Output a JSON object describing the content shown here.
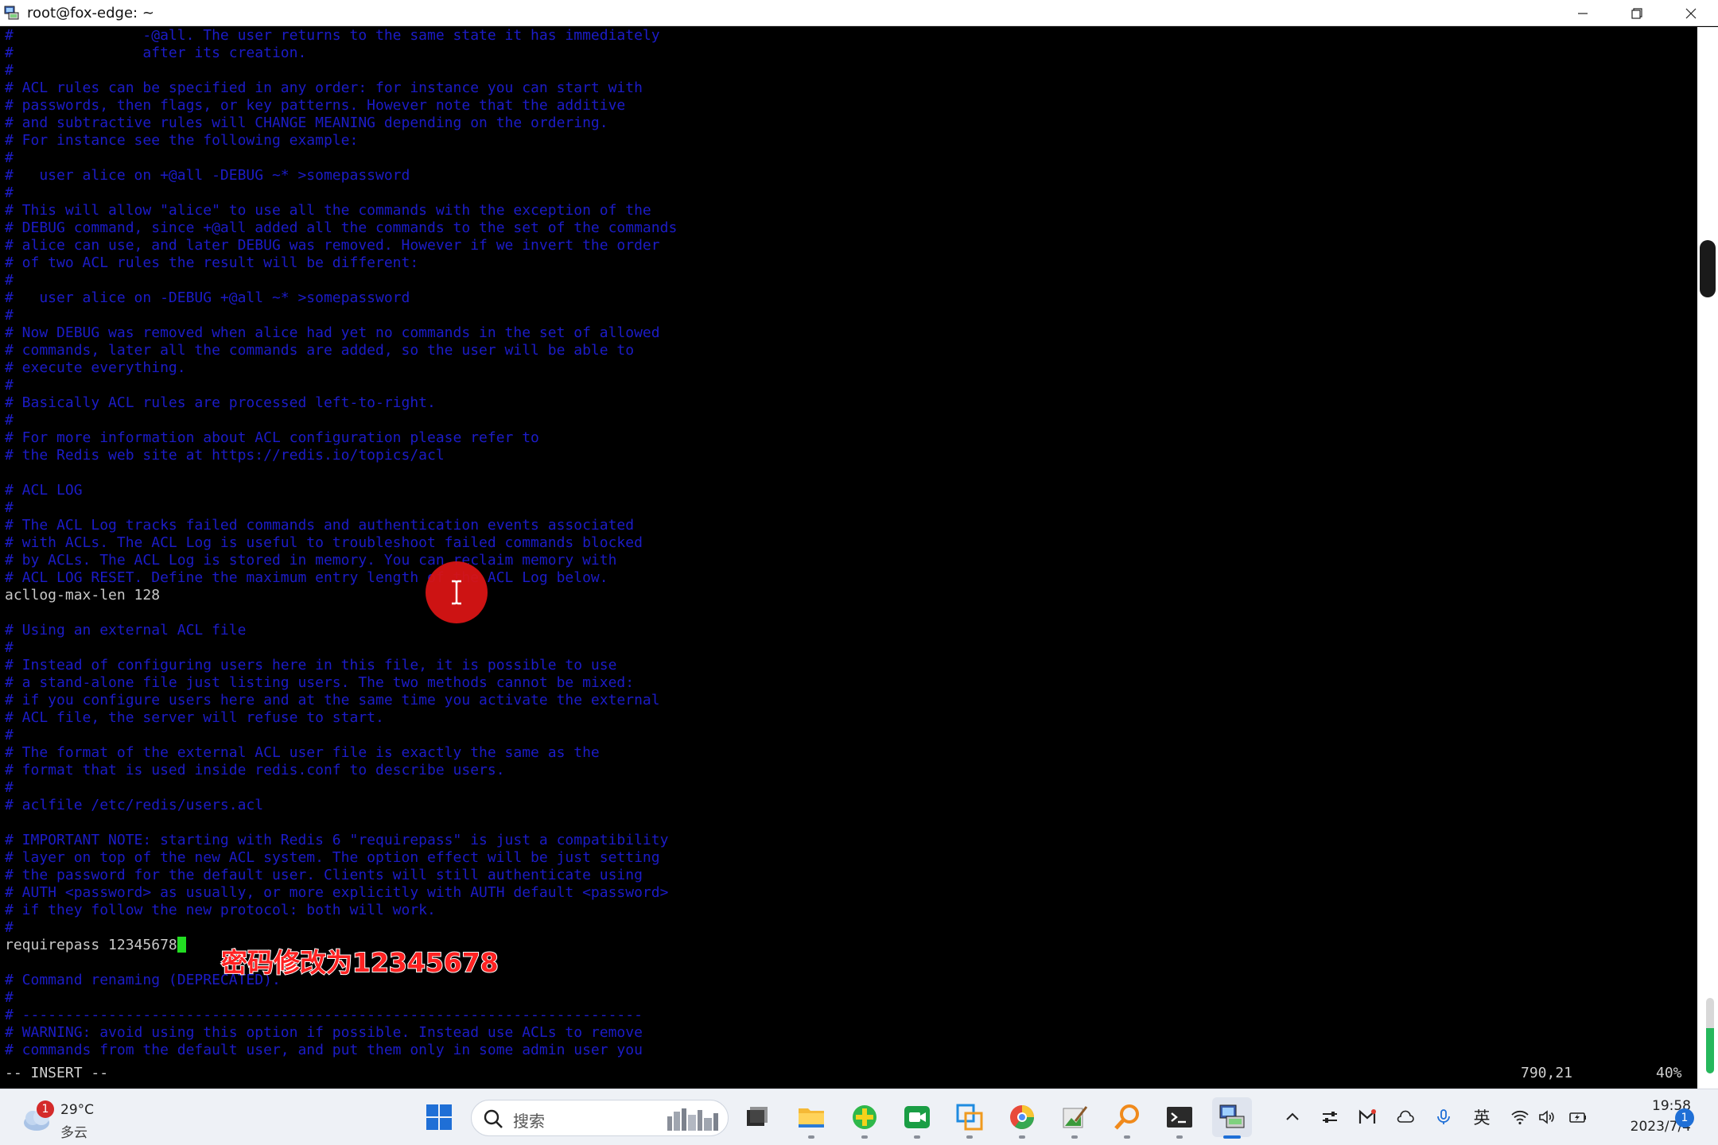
{
  "window": {
    "title": "root@fox-edge: ~"
  },
  "terminal": {
    "lines": [
      {
        "text": "#               -@all. The user returns to the same state it has immediately",
        "kind": "comment"
      },
      {
        "text": "#               after its creation.",
        "kind": "comment"
      },
      {
        "text": "#",
        "kind": "comment"
      },
      {
        "text": "# ACL rules can be specified in any order: for instance you can start with",
        "kind": "comment"
      },
      {
        "text": "# passwords, then flags, or key patterns. However note that the additive",
        "kind": "comment"
      },
      {
        "text": "# and subtractive rules will CHANGE MEANING depending on the ordering.",
        "kind": "comment"
      },
      {
        "text": "# For instance see the following example:",
        "kind": "comment"
      },
      {
        "text": "#",
        "kind": "comment"
      },
      {
        "text": "#   user alice on +@all -DEBUG ~* >somepassword",
        "kind": "comment"
      },
      {
        "text": "#",
        "kind": "comment"
      },
      {
        "text": "# This will allow \"alice\" to use all the commands with the exception of the",
        "kind": "comment"
      },
      {
        "text": "# DEBUG command, since +@all added all the commands to the set of the commands",
        "kind": "comment"
      },
      {
        "text": "# alice can use, and later DEBUG was removed. However if we invert the order",
        "kind": "comment"
      },
      {
        "text": "# of two ACL rules the result will be different:",
        "kind": "comment"
      },
      {
        "text": "#",
        "kind": "comment"
      },
      {
        "text": "#   user alice on -DEBUG +@all ~* >somepassword",
        "kind": "comment"
      },
      {
        "text": "#",
        "kind": "comment"
      },
      {
        "text": "# Now DEBUG was removed when alice had yet no commands in the set of allowed",
        "kind": "comment"
      },
      {
        "text": "# commands, later all the commands are added, so the user will be able to",
        "kind": "comment"
      },
      {
        "text": "# execute everything.",
        "kind": "comment"
      },
      {
        "text": "#",
        "kind": "comment"
      },
      {
        "text": "# Basically ACL rules are processed left-to-right.",
        "kind": "comment"
      },
      {
        "text": "#",
        "kind": "comment"
      },
      {
        "text": "# For more information about ACL configuration please refer to",
        "kind": "comment"
      },
      {
        "text": "# the Redis web site at https://redis.io/topics/acl",
        "kind": "comment"
      },
      {
        "text": "",
        "kind": "comment"
      },
      {
        "text": "# ACL LOG",
        "kind": "comment"
      },
      {
        "text": "#",
        "kind": "comment"
      },
      {
        "text": "# The ACL Log tracks failed commands and authentication events associated",
        "kind": "comment"
      },
      {
        "text": "# with ACLs. The ACL Log is useful to troubleshoot failed commands blocked",
        "kind": "comment"
      },
      {
        "text": "# by ACLs. The ACL Log is stored in memory. You can reclaim memory with",
        "kind": "comment"
      },
      {
        "text": "# ACL LOG RESET. Define the maximum entry length of the ACL Log below.",
        "kind": "comment"
      },
      {
        "text": "acllog-max-len 128",
        "kind": "normal"
      },
      {
        "text": "",
        "kind": "comment"
      },
      {
        "text": "# Using an external ACL file",
        "kind": "comment"
      },
      {
        "text": "#",
        "kind": "comment"
      },
      {
        "text": "# Instead of configuring users here in this file, it is possible to use",
        "kind": "comment"
      },
      {
        "text": "# a stand-alone file just listing users. The two methods cannot be mixed:",
        "kind": "comment"
      },
      {
        "text": "# if you configure users here and at the same time you activate the external",
        "kind": "comment"
      },
      {
        "text": "# ACL file, the server will refuse to start.",
        "kind": "comment"
      },
      {
        "text": "#",
        "kind": "comment"
      },
      {
        "text": "# The format of the external ACL user file is exactly the same as the",
        "kind": "comment"
      },
      {
        "text": "# format that is used inside redis.conf to describe users.",
        "kind": "comment"
      },
      {
        "text": "#",
        "kind": "comment"
      },
      {
        "text": "# aclfile /etc/redis/users.acl",
        "kind": "comment"
      },
      {
        "text": "",
        "kind": "comment"
      },
      {
        "text": "# IMPORTANT NOTE: starting with Redis 6 \"requirepass\" is just a compatibility",
        "kind": "comment"
      },
      {
        "text": "# layer on top of the new ACL system. The option effect will be just setting",
        "kind": "comment"
      },
      {
        "text": "# the password for the default user. Clients will still authenticate using",
        "kind": "comment"
      },
      {
        "text": "# AUTH <password> as usually, or more explicitly with AUTH default <password>",
        "kind": "comment"
      },
      {
        "text": "# if they follow the new protocol: both will work.",
        "kind": "comment"
      },
      {
        "text": "#",
        "kind": "comment"
      },
      {
        "text": "requirepass 12345678",
        "kind": "normal",
        "cursor": true
      },
      {
        "text": "",
        "kind": "comment"
      },
      {
        "text": "# Command renaming (DEPRECATED).",
        "kind": "comment"
      },
      {
        "text": "#",
        "kind": "comment"
      },
      {
        "text": "# ------------------------------------------------------------------------",
        "kind": "comment"
      },
      {
        "text": "# WARNING: avoid using this option if possible. Instead use ACLs to remove",
        "kind": "comment"
      },
      {
        "text": "# commands from the default user, and put them only in some admin user you",
        "kind": "comment"
      }
    ],
    "status": {
      "mode": "-- INSERT --",
      "position": "790,21",
      "percent": "40%"
    },
    "scroll_fraction": 0.4
  },
  "overlay": {
    "caption": "密码修改为12345678",
    "caption_color": "#ff2222",
    "marker_color": "#d81414"
  },
  "taskbar": {
    "weather": {
      "badge": "1",
      "temperature": "29°C",
      "condition": "多云"
    },
    "search_placeholder": "搜索",
    "apps": [
      "windows-start",
      "search",
      "task-view",
      "file-explorer",
      "app-green-plus",
      "video-meeting",
      "remote-desktop",
      "chrome-like-browser",
      "image-editor",
      "search-tool",
      "terminal",
      "network-tool"
    ],
    "tray": {
      "ime_label": "英",
      "time": "19:58",
      "date": "2023/7/4",
      "notification_count": "1"
    },
    "volume_level": 0.6
  },
  "colors": {
    "comment": "#1c1cc8",
    "normal_text": "#c8c8c8",
    "cursor": "#22dd22",
    "background": "#000000",
    "accent": "#1f6fd6"
  }
}
